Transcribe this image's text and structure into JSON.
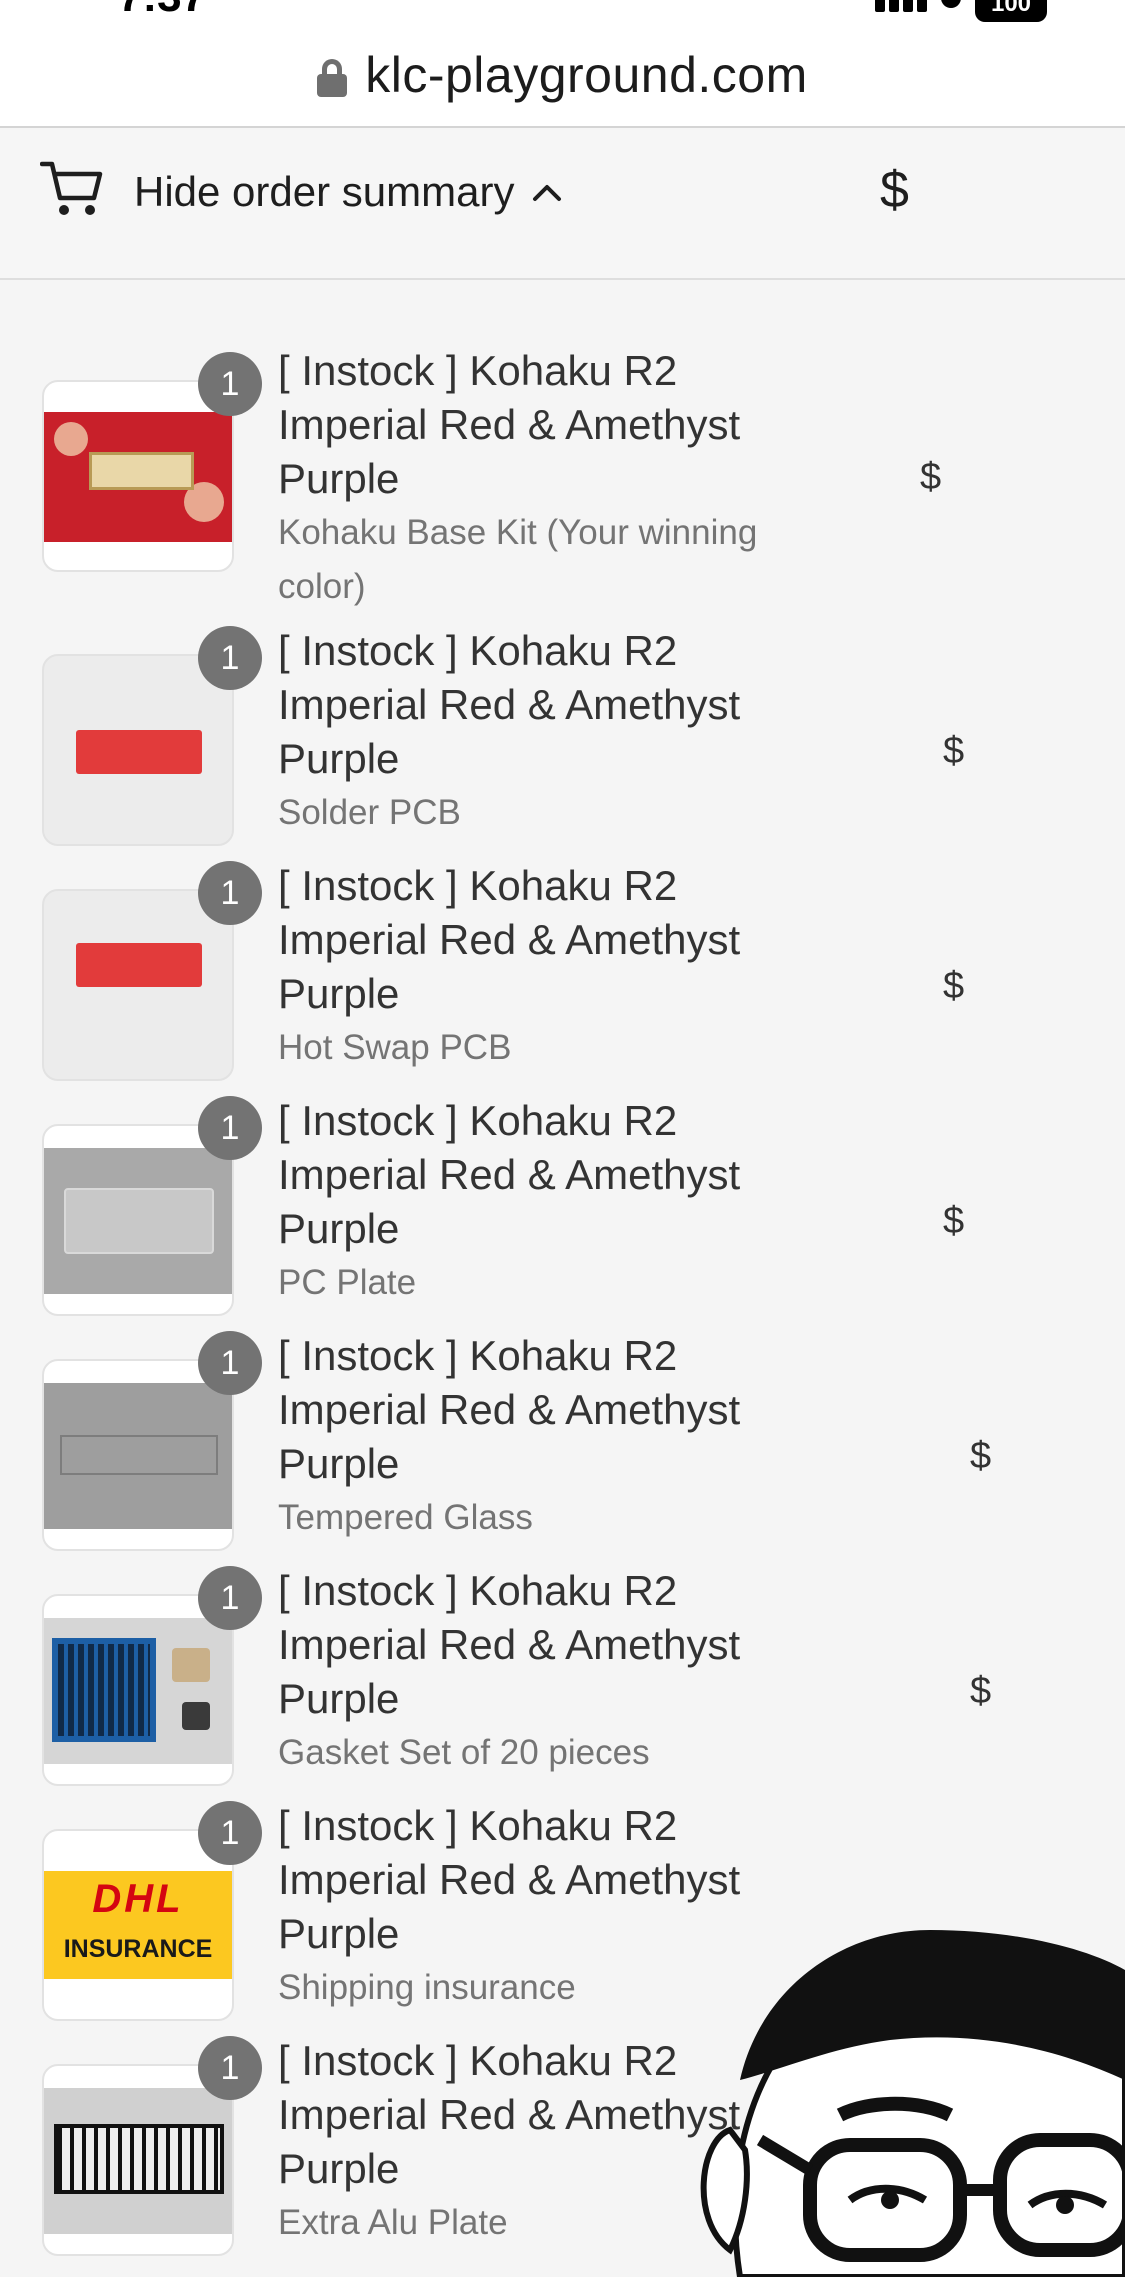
{
  "status_bar": {
    "time": "7:37",
    "battery": "100"
  },
  "browser": {
    "url": "klc-playground.com"
  },
  "summary": {
    "toggle_label": "Hide order summary",
    "total": "$"
  },
  "items": [
    {
      "title": "[ Instock ] Kohaku R2 Imperial Red & Amethyst Purple",
      "variant": "Kohaku Base Kit (Your winning color)",
      "quantity": "1",
      "price": "$",
      "thumbnail": "red-kit-box"
    },
    {
      "title": "[ Instock ] Kohaku R2 Imperial Red & Amethyst Purple",
      "variant": "Solder PCB",
      "quantity": "1",
      "price": "$",
      "thumbnail": "red-pcb"
    },
    {
      "title": "[ Instock ] Kohaku R2 Imperial Red & Amethyst Purple",
      "variant": "Hot Swap PCB",
      "quantity": "1",
      "price": "$",
      "thumbnail": "red-pcb"
    },
    {
      "title": "[ Instock ] Kohaku R2 Imperial Red & Amethyst Purple",
      "variant": "PC Plate",
      "quantity": "1",
      "price": "$",
      "thumbnail": "pc-plate"
    },
    {
      "title": "[ Instock ] Kohaku R2 Imperial Red & Amethyst Purple",
      "variant": "Tempered Glass",
      "quantity": "1",
      "price": "$",
      "thumbnail": "glass-panel"
    },
    {
      "title": "[ Instock ] Kohaku R2 Imperial Red & Amethyst Purple",
      "variant": "Gasket Set of 20 pieces",
      "quantity": "1",
      "price": "$",
      "thumbnail": "gasket-set"
    },
    {
      "title": "[ Instock ] Kohaku R2 Imperial Red & Amethyst Purple",
      "variant": "Shipping insurance",
      "quantity": "1",
      "price": "",
      "thumbnail": "dhl-insurance"
    },
    {
      "title": "[ Instock ] Kohaku R2 Imperial Red & Amethyst Purple",
      "variant": "Extra Alu Plate",
      "quantity": "1",
      "price": "",
      "thumbnail": "alu-plate"
    }
  ],
  "thumbnail_text": {
    "dhl_logo": "DHL",
    "dhl_caption": "INSURANCE"
  },
  "colors": {
    "badge": "#737373",
    "dhl_yellow": "#fcc820",
    "dhl_red": "#d40511",
    "kit_red": "#c8202a"
  }
}
